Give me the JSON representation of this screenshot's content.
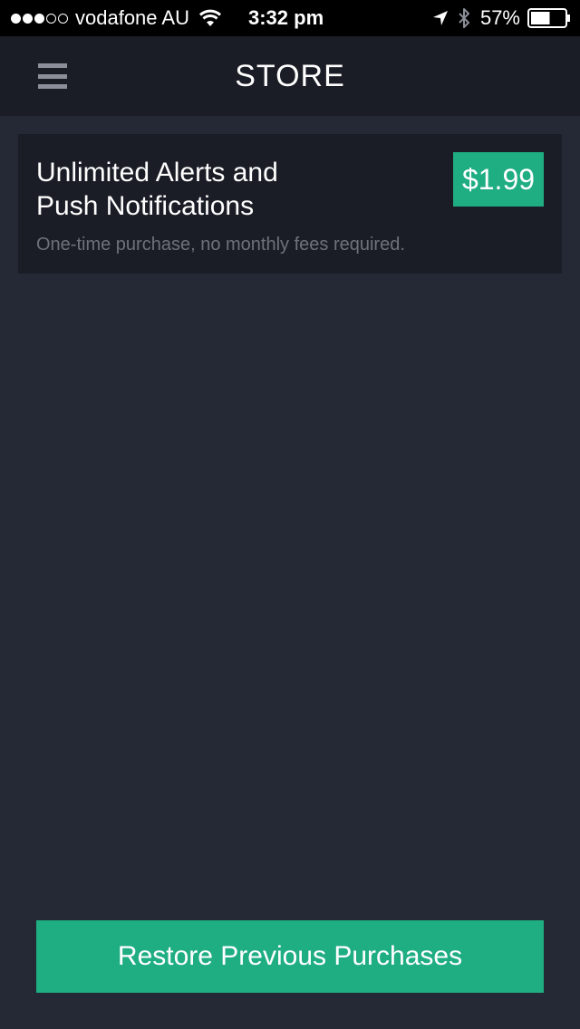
{
  "status_bar": {
    "signal_dots": {
      "filled": 3,
      "total": 5
    },
    "carrier": "vodafone AU",
    "time": "3:32 pm",
    "battery_percent": "57%",
    "battery_level": 0.57,
    "icons": [
      "wifi-icon",
      "location-arrow-icon",
      "bluetooth-icon",
      "battery-icon"
    ]
  },
  "nav": {
    "title": "STORE",
    "menu_icon": "hamburger-menu-icon"
  },
  "products": [
    {
      "title": "Unlimited Alerts and Push Notifications",
      "description": "One-time purchase, no monthly fees required.",
      "price": "$1.99"
    }
  ],
  "restore_label": "Restore Previous Purchases",
  "colors": {
    "background": "#252835",
    "surface": "#1b1d26",
    "accent": "#1fad82",
    "muted_text": "#6e717c",
    "status_bar": "#000000"
  }
}
